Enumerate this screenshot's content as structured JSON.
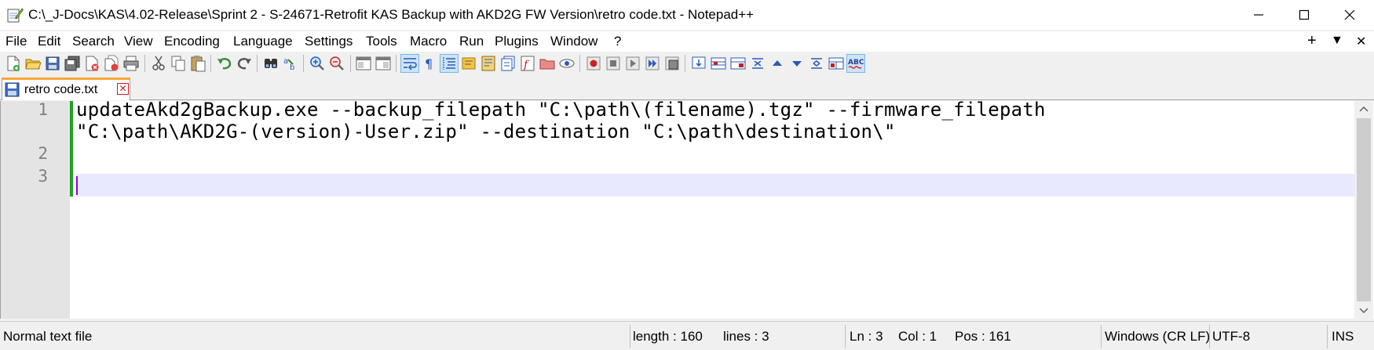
{
  "window": {
    "title": "C:\\_J-Docs\\KAS\\4.02-Release\\Sprint 2 - S-24671-Retrofit KAS Backup with AKD2G FW Version\\retro code.txt - Notepad++",
    "icon": "notepad-pen-icon"
  },
  "menu": {
    "items": [
      "File",
      "Edit",
      "Search",
      "View",
      "Encoding",
      "Language",
      "Settings",
      "Tools",
      "Macro",
      "Run",
      "Plugins",
      "Window",
      "?"
    ],
    "right": [
      "+",
      "▼",
      "✕"
    ]
  },
  "tab": {
    "label": "retro code.txt",
    "close_glyph": "✕",
    "accent": "#f9a634"
  },
  "editor": {
    "line_numbers": [
      "1",
      "2",
      "3"
    ],
    "lines": [
      "updateAkd2gBackup.exe --backup_filepath \"C:\\path\\(filename).tgz\" --firmware_filepath",
      "\"C:\\path\\AKD2G-(version)-User.zip\" --destination \"C:\\path\\destination\\\"",
      "",
      ""
    ],
    "caret_line_color": "#e8e8ff",
    "change_bar_color": "#22a022"
  },
  "status": {
    "type": "Normal text file",
    "length": "length : 160",
    "lines": "lines : 3",
    "ln": "Ln : 3",
    "col": "Col : 1",
    "pos": "Pos : 161",
    "eol": "Windows (CR LF)",
    "encoding": "UTF-8",
    "mode": "INS"
  }
}
